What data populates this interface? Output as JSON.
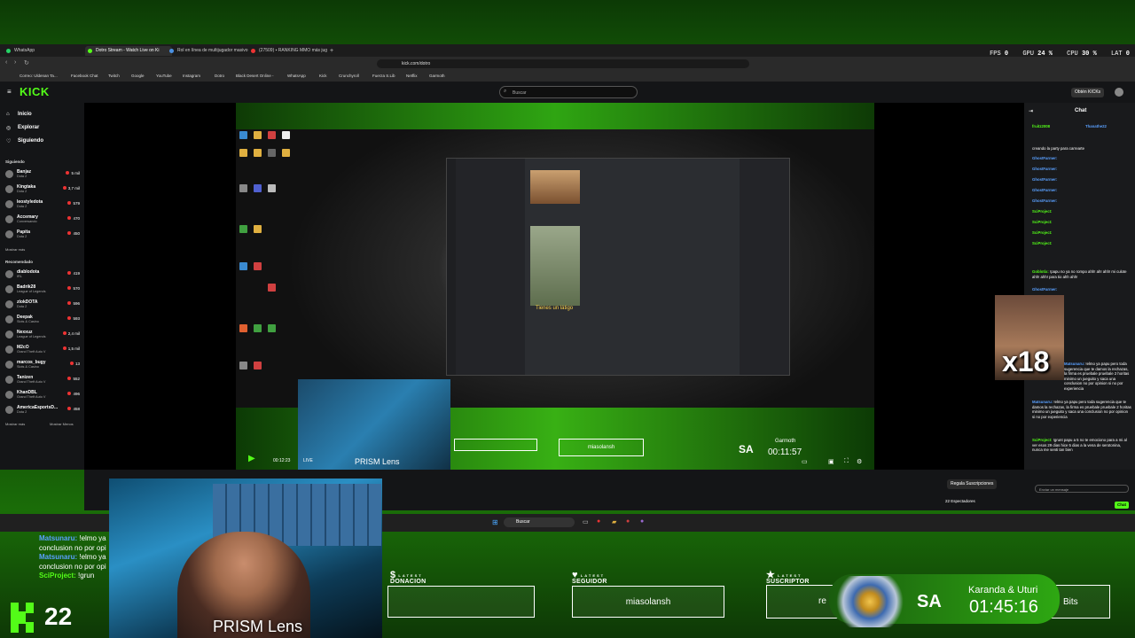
{
  "browser": {
    "tabs": [
      {
        "label": "WhatsApp",
        "color": "#25d366",
        "active": false
      },
      {
        "label": "Dotro Stream - Watch Live on Ki",
        "color": "#53fc18",
        "active": true
      },
      {
        "label": "Rol en línea de multijugador masivo",
        "color": "#4a90e2",
        "active": false
      },
      {
        "label": "(27509) ▪ RANKING MMO más jug",
        "color": "#e33",
        "active": false
      }
    ],
    "url": "kick.com/dotro",
    "bookmarks": [
      "Correo: Uldenan Ta...",
      "Facebook Chat",
      "Twitch",
      "Google",
      "YouTube",
      "Instagram",
      "Dotro",
      "Black Desert Online -",
      "WhatsApp",
      "Kick",
      "Crunchyroll",
      "Fuerza S.Lib",
      "Netflix",
      "Garmoth"
    ]
  },
  "perf_overlay": {
    "fps_label": "FPS",
    "fps": "0",
    "gpu_label": "GPU",
    "gpu": "24 %",
    "cpu_label": "CPU",
    "cpu": "30 %",
    "lat_label": "LAT",
    "lat": "0"
  },
  "kick": {
    "logo": "KICK",
    "search_placeholder": "Buscar",
    "get_kicks": "Obtén KICKs",
    "nav": [
      "Inicio",
      "Explorar",
      "Siguiendo"
    ],
    "following_title": "Siguiendo",
    "following": [
      {
        "name": "Banjaz",
        "game": "Dota 2",
        "viewers": "5 mil"
      },
      {
        "name": "Kingtaka",
        "game": "Dota 2",
        "viewers": "3,7 mil"
      },
      {
        "name": "leostyledota",
        "game": "Dota 2",
        "viewers": "579"
      },
      {
        "name": "Accemary",
        "game": "Conversando",
        "viewers": "470"
      },
      {
        "name": "Papita",
        "game": "Dota 2",
        "viewers": "450"
      }
    ],
    "show_more": "Mostrar más",
    "recommended_title": "Recomendado",
    "recommended": [
      {
        "name": "diablodota",
        "game": "IRL",
        "viewers": "419"
      },
      {
        "name": "Badrik28",
        "game": "League of Legends",
        "viewers": "570"
      },
      {
        "name": "zlokDOTA",
        "game": "Dota 2",
        "viewers": "596"
      },
      {
        "name": "Deepak",
        "game": "Slots & Casino",
        "viewers": "593"
      },
      {
        "name": "Nexxuz",
        "game": "League of Legends",
        "viewers": "2,4 mil"
      },
      {
        "name": "M2cO",
        "game": "Grand Theft Auto V",
        "viewers": "1,5 mil"
      },
      {
        "name": "marcos_bugy",
        "game": "Slots & Casino",
        "viewers": "13"
      },
      {
        "name": "Tanizen",
        "game": "Grand Theft Auto V",
        "viewers": "552"
      },
      {
        "name": "KhanDBL",
        "game": "Grand Theft Auto V",
        "viewers": "496"
      },
      {
        "name": "AmericaEsportsD...",
        "game": "Dota 2",
        "viewers": "458"
      }
    ],
    "show_more2": "Mostrar más",
    "show_less": "Mostrar Menos",
    "chat_title": "Chat",
    "chat_top": [
      {
        "user": "fruitz2008",
        "text": ""
      },
      {
        "user": "Thanathe22",
        "text": ""
      },
      {
        "user": "",
        "text": "creando la party para carrearte"
      }
    ],
    "chat_messages": [
      {
        "user": "GhostFarmer:",
        "text": "",
        "color": "blue"
      },
      {
        "user": "GhostFarmer:",
        "text": "",
        "color": "blue"
      },
      {
        "user": "GhostFarmer:",
        "text": "",
        "color": "blue"
      },
      {
        "user": "GhostFarmer:",
        "text": "",
        "color": "blue"
      },
      {
        "user": "GhostFarmer:",
        "text": "",
        "color": "blue"
      },
      {
        "user": "SciProject:",
        "text": "",
        "color": "green"
      },
      {
        "user": "SciProject:",
        "text": "",
        "color": "green"
      },
      {
        "user": "SciProject:",
        "text": "",
        "color": "green"
      },
      {
        "user": "SciProject:",
        "text": "",
        "color": "green"
      },
      {
        "user": "Goblotix:",
        "text": "!papu no ya no rompo ahh! ah! ahh! mi culote ahh! ahh! para tio ahh ahh!",
        "color": "green"
      },
      {
        "user": "GhostFarmer:",
        "text": "",
        "color": "blue"
      },
      {
        "user": "Matsunaru:",
        "text": "!elmo ya papu pero toda sugerencia que te damos la rechazas, la firma es pruebale pruebale 2 horitas minimo un jueguito y saca una conclusion no por opinion si no por experiencia",
        "color": "blue"
      },
      {
        "user": "Matsunaru:",
        "text": "!elmo ya papu pero toda sugerencia que te damos la rechazas, la firma es pruebale pruebale 2 horitas minimo un jueguito y saca una conclusion no por opinion si no por experiencia",
        "color": "blue"
      },
      {
        "user": "SciProject:",
        "text": "!grunt papu a 5 no te emociono para a mi al ver esos 29 dias hice 5 dias a la vena de serotonina, nunca me senti tan bien",
        "color": "green"
      }
    ],
    "subscribe_button": "Regala Suscripciones",
    "message_placeholder": "Enviar un mensaje",
    "chat_button": "Chat",
    "spectators": "22 Espectadores"
  },
  "inner_stream": {
    "gif_caption": "Tienes un látigo",
    "timer_initials": "SA",
    "timer_name": "Garmoth",
    "timer_value": "00:11:57",
    "follower_small": "miasolansh",
    "cam_label_small": "PRISM Lens",
    "live_label": "LIVE",
    "time_small": "00:12:23"
  },
  "taskbar": {
    "search": "Buscar"
  },
  "overlay": {
    "chat_lines": [
      {
        "user": "Matsunaru:",
        "text": "!elmo ya",
        "color": "#5aa0ff"
      },
      {
        "user": "",
        "text": "conclusion no por opi",
        "color": ""
      },
      {
        "user": "Matsunaru:",
        "text": "!elmo ya",
        "color": "#5aa0ff"
      },
      {
        "user": "",
        "text": "conclusion no por opi",
        "color": ""
      },
      {
        "user": "SciProject:",
        "text": "!grun",
        "color": "#53fc18"
      }
    ],
    "viewer_count": "22",
    "cam_label": "PRISM Lens",
    "latest_label": "LATEST",
    "donation_label": "DONACION",
    "follower_label": "SEGUIDOR",
    "subscriber_label": "SUSCRIPTOR",
    "donation_value": "",
    "follower_value": "miasolansh",
    "subscriber_value_partial": "re",
    "bits_value": "Bits",
    "timer_initials": "SA",
    "timer_name": "Karanda & Uturi",
    "timer_value": "01:45:16"
  },
  "colors": {
    "kick_green": "#53fc18",
    "overlay_green": "#2ea812",
    "bg_dark": "#141517"
  }
}
